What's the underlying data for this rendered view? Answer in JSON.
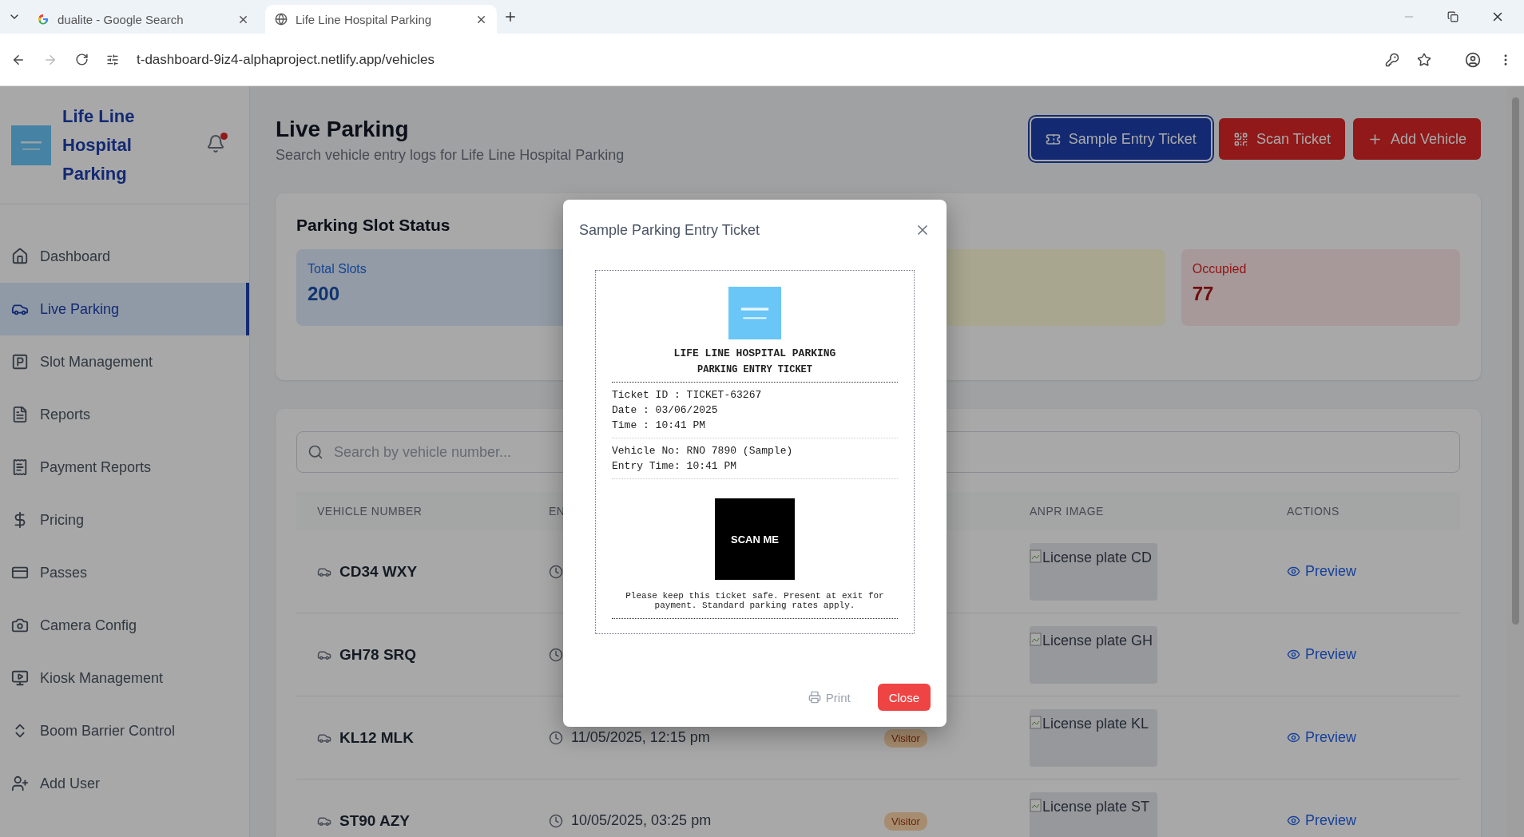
{
  "browser": {
    "tabs": [
      {
        "title": "dualite - Google Search",
        "kind": "google",
        "selected": false
      },
      {
        "title": "Life Line Hospital Parking",
        "kind": "globe",
        "selected": true
      }
    ],
    "url": "t-dashboard-9iz4-alphaproject.netlify.app/vehicles"
  },
  "sidebar": {
    "title": "Life Line Hospital Parking",
    "notification": true,
    "items": [
      {
        "label": "Dashboard",
        "selected": false
      },
      {
        "label": "Live Parking",
        "selected": true
      },
      {
        "label": "Slot Management",
        "selected": false
      },
      {
        "label": "Reports",
        "selected": false
      },
      {
        "label": "Payment Reports",
        "selected": false
      },
      {
        "label": "Pricing",
        "selected": false
      },
      {
        "label": "Passes",
        "selected": false
      },
      {
        "label": "Camera Config",
        "selected": false
      },
      {
        "label": "Kiosk Management",
        "selected": false
      },
      {
        "label": "Boom Barrier Control",
        "selected": false
      },
      {
        "label": "Add User",
        "selected": false
      }
    ]
  },
  "header": {
    "title": "Live Parking",
    "subtitle": "Search vehicle entry logs for Life Line Hospital Parking",
    "buttons": [
      {
        "label": "Sample Entry Ticket",
        "kind": "primary"
      },
      {
        "label": "Scan Ticket",
        "kind": "danger"
      },
      {
        "label": "Add Vehicle",
        "kind": "danger"
      }
    ]
  },
  "slot_status": {
    "title": "Parking Slot Status",
    "cards": [
      {
        "label": "Total Slots",
        "value": "200",
        "color": "#949ba6"
      },
      {
        "color": "#a8a68f"
      },
      {
        "label": "Occupied",
        "value": "77",
        "color": "#a79999"
      }
    ]
  },
  "table": {
    "search": {
      "placeholder": "Search by vehicle number..."
    },
    "columns": [
      "VEHICLE NUMBER",
      "EN",
      "ANPR IMAGE",
      "ACTIONS"
    ],
    "rows": [
      {
        "vehicle": "CD34 WXY",
        "anpr": "License plate CD",
        "action": "Preview"
      },
      {
        "vehicle": "GH78 SRQ",
        "anpr": "License plate GH",
        "action": "Preview"
      },
      {
        "vehicle": "KL12 MLK",
        "entry_time": "11/05/2025, 12:15 pm",
        "type": "Visitor",
        "anpr": "License plate KL",
        "action": "Preview"
      },
      {
        "vehicle": "ST90 AZY",
        "entry_time": "10/05/2025, 03:25 pm",
        "type": "Visitor",
        "anpr": "License plate ST",
        "action": "Preview"
      }
    ]
  },
  "modal": {
    "title": "Sample Parking Entry Ticket",
    "ticket": {
      "heading": "LIFE LINE HOSPITAL PARKING",
      "subheading": "PARKING ENTRY TICKET",
      "groups": [
        [
          "Ticket ID : TICKET-63267",
          "Date : 03/06/2025",
          "Time : 10:41 PM"
        ],
        [
          "Vehicle No: RNO 7890 (Sample)",
          "Entry Time: 10:41 PM"
        ]
      ],
      "code_label": "SCAN ME",
      "note": "Please keep this ticket safe. Present at exit for payment. Standard parking rates apply."
    },
    "buttons": [
      {
        "label": "Print",
        "kind": "ghost"
      },
      {
        "label": "Close",
        "kind": "danger"
      }
    ]
  }
}
